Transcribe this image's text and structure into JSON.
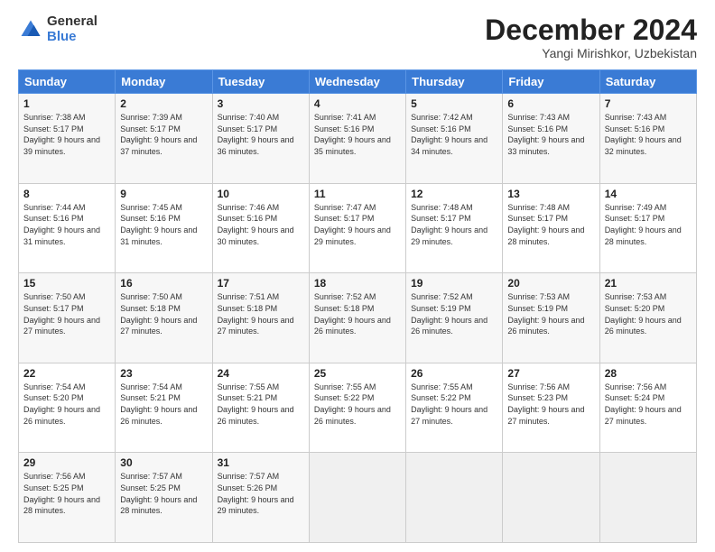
{
  "logo": {
    "general": "General",
    "blue": "Blue"
  },
  "header": {
    "month": "December 2024",
    "location": "Yangi Mirishkor, Uzbekistan"
  },
  "weekdays": [
    "Sunday",
    "Monday",
    "Tuesday",
    "Wednesday",
    "Thursday",
    "Friday",
    "Saturday"
  ],
  "weeks": [
    [
      {
        "day": "1",
        "sunrise": "7:38 AM",
        "sunset": "5:17 PM",
        "daylight": "9 hours and 39 minutes."
      },
      {
        "day": "2",
        "sunrise": "7:39 AM",
        "sunset": "5:17 PM",
        "daylight": "9 hours and 37 minutes."
      },
      {
        "day": "3",
        "sunrise": "7:40 AM",
        "sunset": "5:17 PM",
        "daylight": "9 hours and 36 minutes."
      },
      {
        "day": "4",
        "sunrise": "7:41 AM",
        "sunset": "5:16 PM",
        "daylight": "9 hours and 35 minutes."
      },
      {
        "day": "5",
        "sunrise": "7:42 AM",
        "sunset": "5:16 PM",
        "daylight": "9 hours and 34 minutes."
      },
      {
        "day": "6",
        "sunrise": "7:43 AM",
        "sunset": "5:16 PM",
        "daylight": "9 hours and 33 minutes."
      },
      {
        "day": "7",
        "sunrise": "7:43 AM",
        "sunset": "5:16 PM",
        "daylight": "9 hours and 32 minutes."
      }
    ],
    [
      {
        "day": "8",
        "sunrise": "7:44 AM",
        "sunset": "5:16 PM",
        "daylight": "9 hours and 31 minutes."
      },
      {
        "day": "9",
        "sunrise": "7:45 AM",
        "sunset": "5:16 PM",
        "daylight": "9 hours and 31 minutes."
      },
      {
        "day": "10",
        "sunrise": "7:46 AM",
        "sunset": "5:16 PM",
        "daylight": "9 hours and 30 minutes."
      },
      {
        "day": "11",
        "sunrise": "7:47 AM",
        "sunset": "5:17 PM",
        "daylight": "9 hours and 29 minutes."
      },
      {
        "day": "12",
        "sunrise": "7:48 AM",
        "sunset": "5:17 PM",
        "daylight": "9 hours and 29 minutes."
      },
      {
        "day": "13",
        "sunrise": "7:48 AM",
        "sunset": "5:17 PM",
        "daylight": "9 hours and 28 minutes."
      },
      {
        "day": "14",
        "sunrise": "7:49 AM",
        "sunset": "5:17 PM",
        "daylight": "9 hours and 28 minutes."
      }
    ],
    [
      {
        "day": "15",
        "sunrise": "7:50 AM",
        "sunset": "5:17 PM",
        "daylight": "9 hours and 27 minutes."
      },
      {
        "day": "16",
        "sunrise": "7:50 AM",
        "sunset": "5:18 PM",
        "daylight": "9 hours and 27 minutes."
      },
      {
        "day": "17",
        "sunrise": "7:51 AM",
        "sunset": "5:18 PM",
        "daylight": "9 hours and 27 minutes."
      },
      {
        "day": "18",
        "sunrise": "7:52 AM",
        "sunset": "5:18 PM",
        "daylight": "9 hours and 26 minutes."
      },
      {
        "day": "19",
        "sunrise": "7:52 AM",
        "sunset": "5:19 PM",
        "daylight": "9 hours and 26 minutes."
      },
      {
        "day": "20",
        "sunrise": "7:53 AM",
        "sunset": "5:19 PM",
        "daylight": "9 hours and 26 minutes."
      },
      {
        "day": "21",
        "sunrise": "7:53 AM",
        "sunset": "5:20 PM",
        "daylight": "9 hours and 26 minutes."
      }
    ],
    [
      {
        "day": "22",
        "sunrise": "7:54 AM",
        "sunset": "5:20 PM",
        "daylight": "9 hours and 26 minutes."
      },
      {
        "day": "23",
        "sunrise": "7:54 AM",
        "sunset": "5:21 PM",
        "daylight": "9 hours and 26 minutes."
      },
      {
        "day": "24",
        "sunrise": "7:55 AM",
        "sunset": "5:21 PM",
        "daylight": "9 hours and 26 minutes."
      },
      {
        "day": "25",
        "sunrise": "7:55 AM",
        "sunset": "5:22 PM",
        "daylight": "9 hours and 26 minutes."
      },
      {
        "day": "26",
        "sunrise": "7:55 AM",
        "sunset": "5:22 PM",
        "daylight": "9 hours and 27 minutes."
      },
      {
        "day": "27",
        "sunrise": "7:56 AM",
        "sunset": "5:23 PM",
        "daylight": "9 hours and 27 minutes."
      },
      {
        "day": "28",
        "sunrise": "7:56 AM",
        "sunset": "5:24 PM",
        "daylight": "9 hours and 27 minutes."
      }
    ],
    [
      {
        "day": "29",
        "sunrise": "7:56 AM",
        "sunset": "5:25 PM",
        "daylight": "9 hours and 28 minutes."
      },
      {
        "day": "30",
        "sunrise": "7:57 AM",
        "sunset": "5:25 PM",
        "daylight": "9 hours and 28 minutes."
      },
      {
        "day": "31",
        "sunrise": "7:57 AM",
        "sunset": "5:26 PM",
        "daylight": "9 hours and 29 minutes."
      },
      null,
      null,
      null,
      null
    ]
  ]
}
